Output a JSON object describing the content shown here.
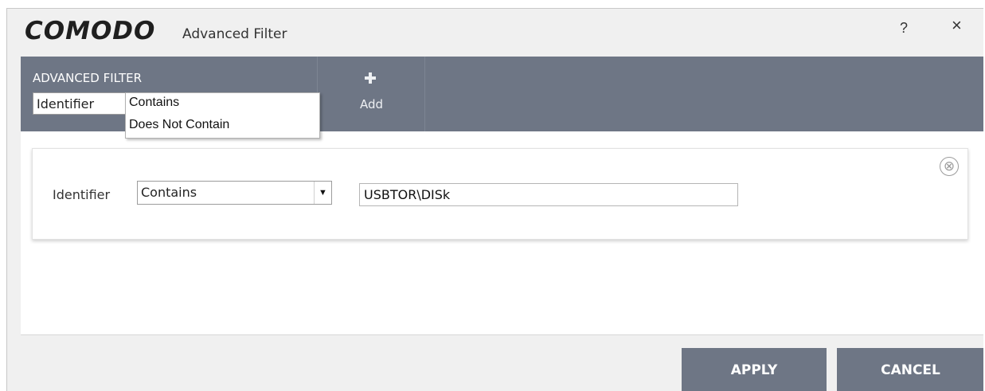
{
  "window": {
    "logo": "COMODO",
    "title": "Advanced Filter",
    "help": "?",
    "close": "×"
  },
  "toolbar": {
    "section_title": "ADVANCED FILTER",
    "filter_select_value": "Identifier",
    "add_label": "Add"
  },
  "rule": {
    "field_label": "Identifier",
    "operator_value": "Contains",
    "value_input": "USBTOR\\DISk",
    "remove_icon": "⊗",
    "operator_options": [
      "Contains",
      "Does Not Contain"
    ]
  },
  "footer": {
    "apply_label": "APPLY",
    "cancel_label": "CANCEL"
  },
  "colors": {
    "toolbar_bg": "#6e7685",
    "button_bg": "#6e7685",
    "window_bg": "#f0f0f0"
  }
}
